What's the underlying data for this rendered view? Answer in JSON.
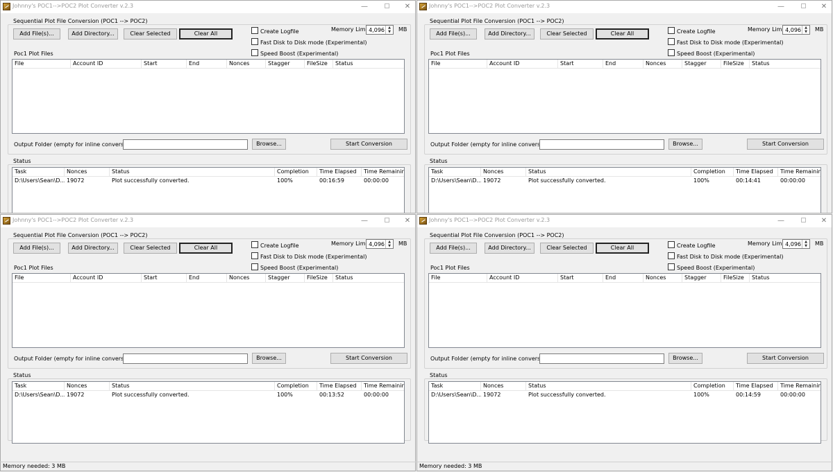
{
  "app": {
    "title": "Johnny's POC1-->POC2 Plot Converter v.2.3",
    "group_title": "Sequential Plot File Conversion (POC1 --> POC2)",
    "buttons": {
      "add_files": "Add File(s)...",
      "add_directory": "Add Directory...",
      "clear_selected": "Clear Selected",
      "clear_all": "Clear All",
      "browse": "Browse...",
      "start_conversion": "Start Conversion"
    },
    "checkboxes": {
      "create_logfile": "Create Logfile",
      "fast_disk": "Fast Disk to Disk mode (Experimental)",
      "speed_boost": "Speed Boost (Experimental)"
    },
    "memory_limit_label": "Memory Limit",
    "memory_limit_value": "4,096",
    "memory_unit": "MB",
    "plot_files_label": "Poc1 Plot Files",
    "file_columns": [
      "File",
      "Account ID",
      "Start",
      "End",
      "Nonces",
      "Stagger",
      "FileSize",
      "Status"
    ],
    "output_folder_label": "Output Folder (empty for inline conversion):",
    "output_folder_value": "",
    "status_group_title": "Status",
    "status_columns": [
      "Task",
      "Nonces",
      "Status",
      "Completion",
      "Time Elapsed",
      "Time Remaining"
    ]
  },
  "windows": [
    {
      "row": {
        "task": "D:\\Users\\Sean\\D...",
        "nonces": "19072",
        "status": "Plot successfully converted.",
        "completion": "100%",
        "elapsed": "00:16:59",
        "remaining": "00:00:00"
      }
    },
    {
      "row": {
        "task": "D:\\Users\\Sean\\D...",
        "nonces": "19072",
        "status": "Plot successfully converted.",
        "completion": "100%",
        "elapsed": "00:14:41",
        "remaining": "00:00:00"
      }
    },
    {
      "row": {
        "task": "D:\\Users\\Sean\\D...",
        "nonces": "19072",
        "status": "Plot successfully converted.",
        "completion": "100%",
        "elapsed": "00:13:52",
        "remaining": "00:00:00"
      }
    },
    {
      "row": {
        "task": "D:\\Users\\Sean\\D...",
        "nonces": "19072",
        "status": "Plot successfully converted.",
        "completion": "100%",
        "elapsed": "00:14:59",
        "remaining": "00:00:00"
      }
    }
  ],
  "footer": {
    "memory_needed": "Memory needed: 3 MB"
  }
}
